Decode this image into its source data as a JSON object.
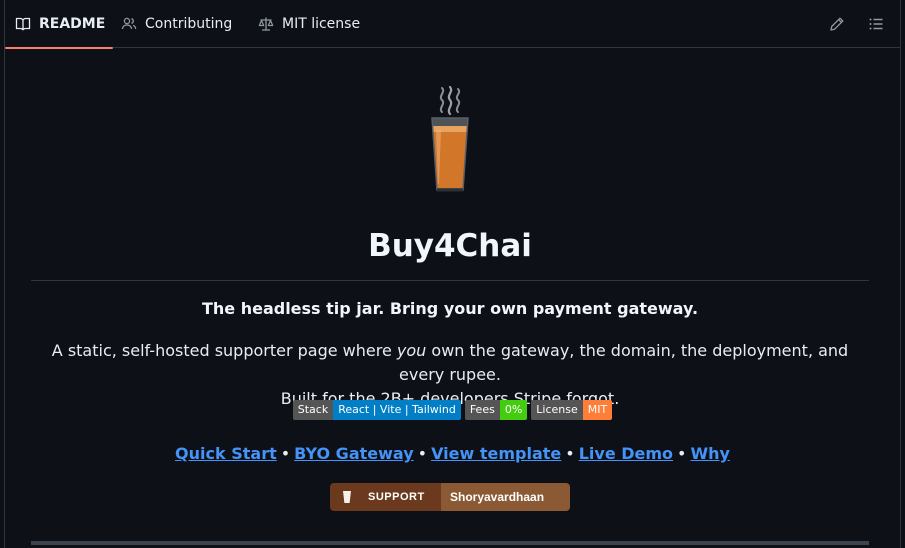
{
  "tabs": [
    {
      "label": "README",
      "icon": "book-icon",
      "active": true
    },
    {
      "label": "Contributing",
      "icon": "people-icon"
    },
    {
      "label": "MIT license",
      "icon": "law-icon"
    }
  ],
  "toolbar": {
    "edit_icon": "pencil-icon",
    "outline_icon": "list-unordered-icon"
  },
  "readme": {
    "title": "Buy4Chai",
    "tagline": "The headless tip jar. Bring your own payment gateway.",
    "desc_part1": "A static, self-hosted supporter page where ",
    "desc_em": "you",
    "desc_part2": " own the gateway, the domain, the deployment, and every rupee.",
    "desc_line2": "Built for the 2B+ developers Stripe forgot.",
    "badges": [
      {
        "label": "Stack",
        "value": "React | Vite | Tailwind",
        "color": "#007ec6"
      },
      {
        "label": "Fees",
        "value": "0%",
        "color": "#4c1"
      },
      {
        "label": "License",
        "value": "MIT",
        "color": "#fe7d37"
      }
    ],
    "links": [
      "Quick Start",
      "BYO Gateway",
      "View template",
      "Live Demo",
      "Why"
    ],
    "separator": "•",
    "support": {
      "label": "SUPPORT",
      "name": "Shoryavardhaan",
      "icon": "chai-cup-icon"
    }
  },
  "colors": {
    "background": "#0d1117",
    "accent_tab": "#f78166",
    "link": "#4493f8",
    "border": "#30363d"
  }
}
